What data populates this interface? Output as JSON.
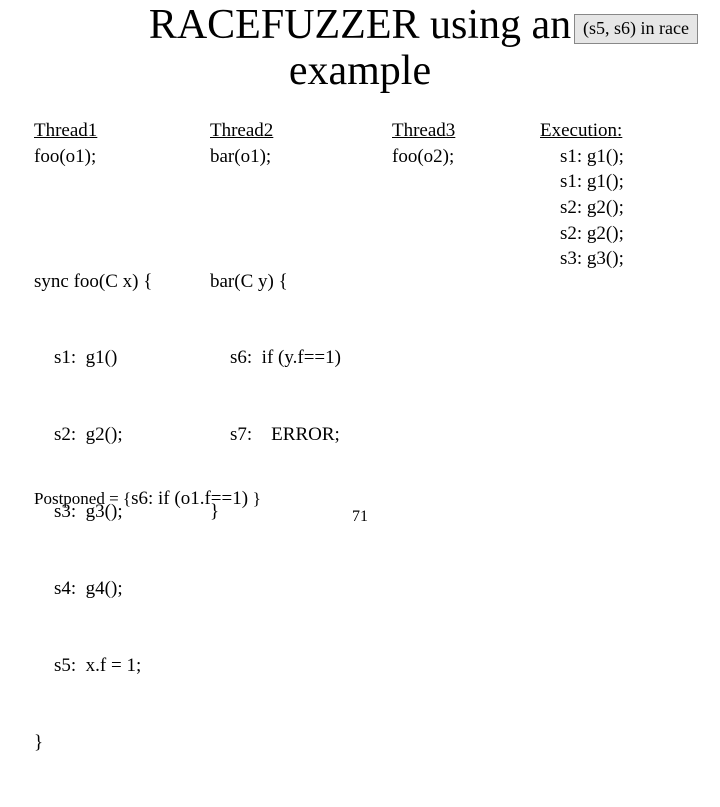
{
  "title_line1": "RACEFUZZER using an",
  "title_line2": "example",
  "race_badge": "(s5, s6) in race",
  "thread1": {
    "header": "Thread1",
    "call": "foo(o1);",
    "foo_sig": "sync foo(C x) {",
    "s1": "s1:  g1()",
    "s2": "s2:  g2();",
    "s3": "s3:  g3();",
    "s4": "s4:  g4();",
    "s5": "s5:  x.f = 1;",
    "close": "}"
  },
  "thread2": {
    "header": "Thread2",
    "call": "bar(o1);",
    "bar_sig": "bar(C y) {",
    "s6": "s6:  if (y.f==1)",
    "s7": "s7:    ERROR;",
    "close": "}"
  },
  "thread3": {
    "header": "Thread3",
    "call": "foo(o2);"
  },
  "execution": {
    "header": "Execution:",
    "lines": [
      "s1:  g1();",
      "s1:  g1();",
      "s2:  g2();",
      "s2:  g2();",
      "s3:  g3();"
    ]
  },
  "postponed_label": "Postponed = {",
  "postponed_body": "s6:  if (o1.f==1) ",
  "postponed_close": "}",
  "slide_number": "71"
}
